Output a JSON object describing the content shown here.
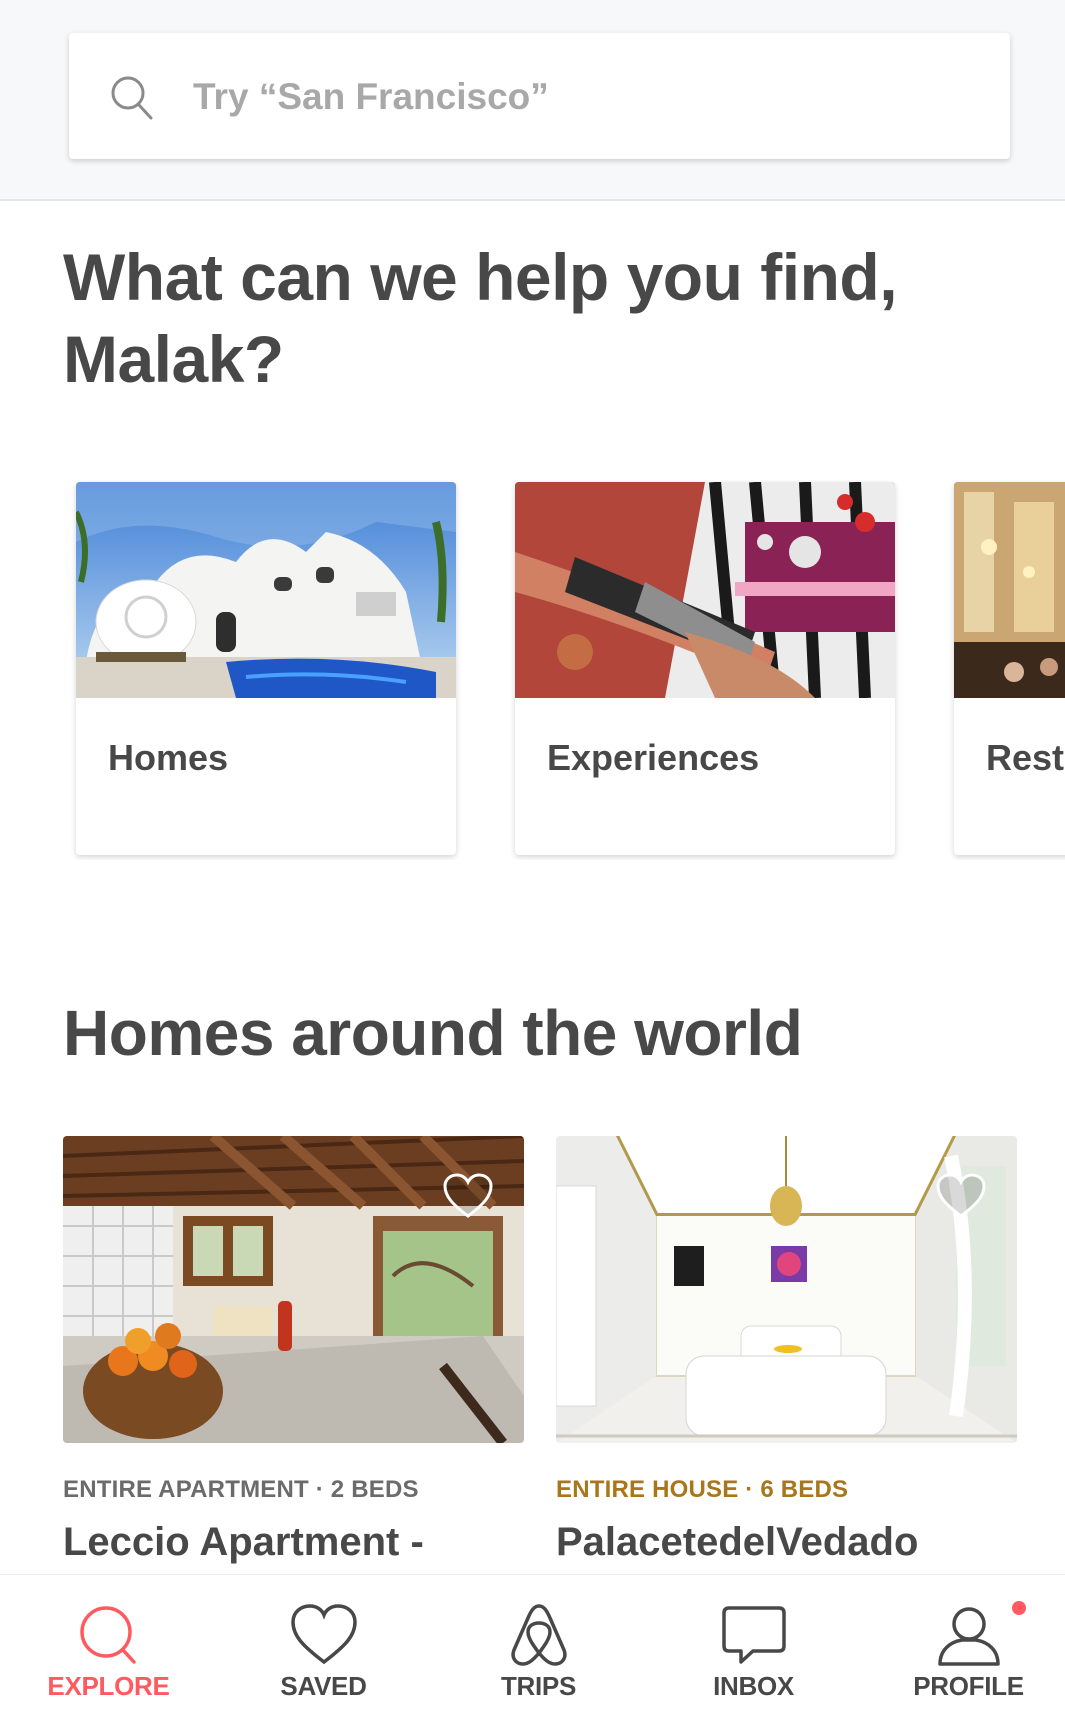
{
  "search": {
    "placeholder": "Try “San Francisco”",
    "icon": "search-icon"
  },
  "greeting": {
    "line1": "What can we help you find,",
    "line2": "Malak?"
  },
  "categories": [
    {
      "label": "Homes"
    },
    {
      "label": "Experiences"
    },
    {
      "label": "Resta"
    }
  ],
  "section": {
    "title": "Homes around the world"
  },
  "listings": [
    {
      "kind": "ENTIRE APARTMENT · 2 BEDS",
      "kind_color": "#6b6b6b",
      "name": "Leccio Apartment -"
    },
    {
      "kind": "ENTIRE HOUSE · 6 BEDS",
      "kind_color": "#a9761b",
      "name": "PalacetedelVedado"
    }
  ],
  "nav": {
    "items": [
      {
        "label": "EXPLORE",
        "icon": "search-icon",
        "active": true
      },
      {
        "label": "SAVED",
        "icon": "heart-icon",
        "active": false
      },
      {
        "label": "TRIPS",
        "icon": "airbnb-logo-icon",
        "active": false
      },
      {
        "label": "INBOX",
        "icon": "chat-bubble-icon",
        "active": false
      },
      {
        "label": "PROFILE",
        "icon": "person-icon",
        "active": false
      }
    ]
  },
  "colors": {
    "brand": "#ff5a5f",
    "text": "#484848",
    "muted": "#a8a8a8",
    "header_bg": "#f7f8fa"
  }
}
